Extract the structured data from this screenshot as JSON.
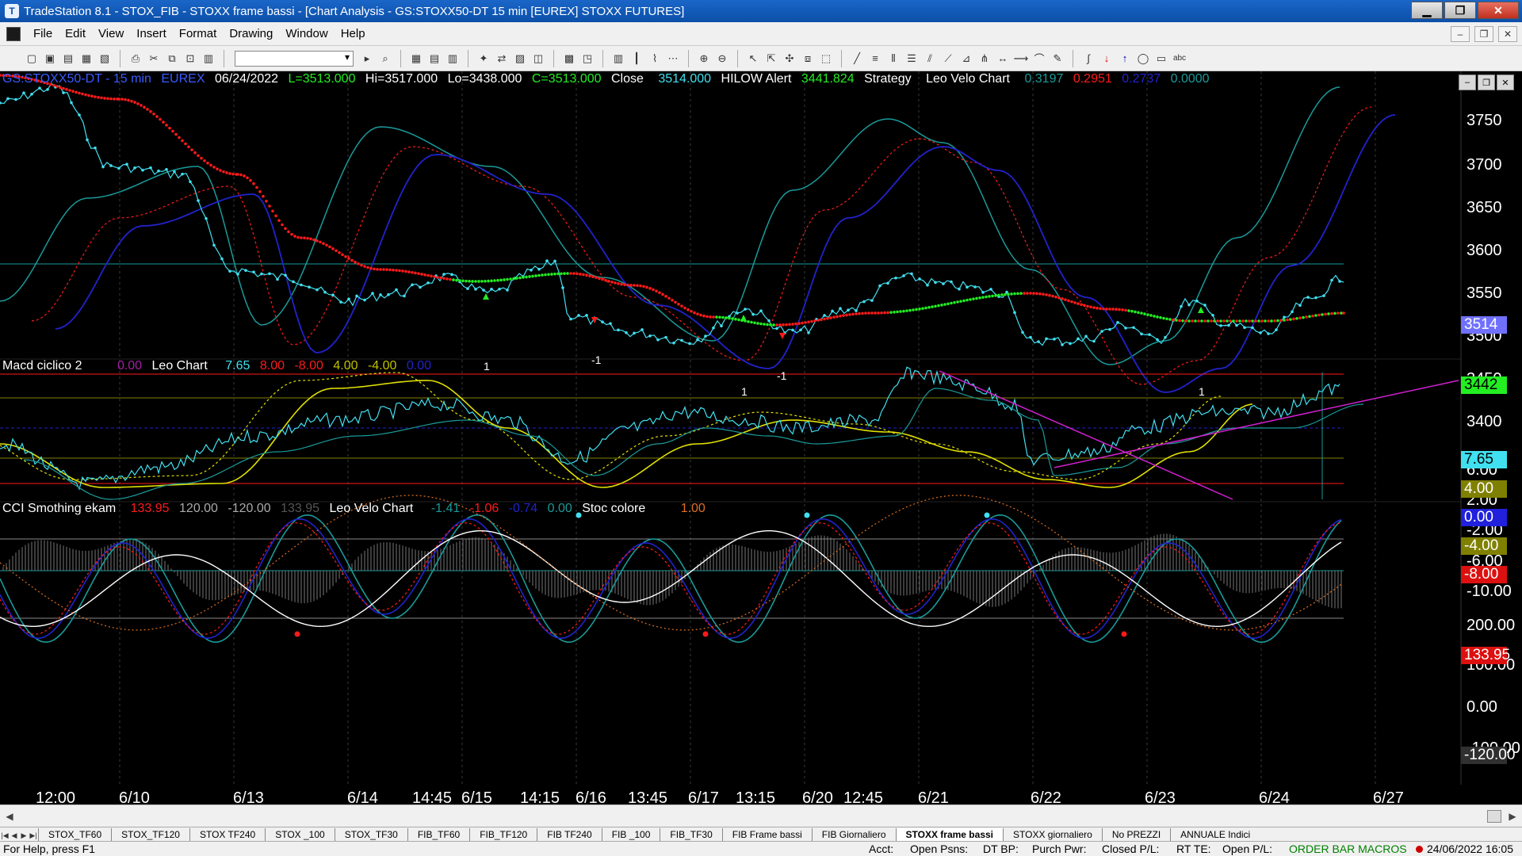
{
  "window": {
    "title": "TradeStation 8.1 - STOX_FIB - STOXX frame bassi - [Chart Analysis - GS:STOXX50-DT  15 min  [EUREX] STOXX FUTURES]",
    "minimize": "▁",
    "restore": "❐",
    "close": "✕"
  },
  "menu": [
    "File",
    "Edit",
    "View",
    "Insert",
    "Format",
    "Drawing",
    "Window",
    "Help"
  ],
  "chart": {
    "header": {
      "symbol": "GS:STOXX50-DT - 15 min",
      "exchange": "EUREX",
      "date": "06/24/2022",
      "last": "L=3513.000",
      "high": "Hi=3517.000",
      "low": "Lo=3438.000",
      "close_field": "C=3513.000",
      "close_label": "Close",
      "close_val": "3514.000",
      "hilow_label": "HILOW Alert",
      "hilow_val": "3441.824",
      "strategy_label": "Strategy",
      "leovelo_label": "Leo Velo Chart",
      "v1": "0.3197",
      "v2": "0.2951",
      "v3": "0.2737",
      "v4": "0.0000"
    },
    "macd_header": {
      "label": "Macd ciclico 2",
      "val": "0.00",
      "leo": "Leo Chart",
      "a": "7.65",
      "b": "8.00",
      "c": "-8.00",
      "d": "4.00",
      "e": "-4.00",
      "f": "0.00"
    },
    "cci_header": {
      "label": "CCI Smothing ekam",
      "a": "133.95",
      "b": "120.00",
      "c": "-120.00",
      "d": "133.95",
      "leo": "Leo Velo Chart",
      "e": "-1.41",
      "f": "-1.06",
      "g": "-0.74",
      "h": "0.00",
      "stoc": "Stoc colore",
      "i": "1.00"
    },
    "price_axis": [
      "3750",
      "3700",
      "3650",
      "3600",
      "3550",
      "3500",
      "3450",
      "3400"
    ],
    "price_tags": {
      "last": "3514",
      "hilow": "3442"
    },
    "macd_axis": [
      "6.00",
      "2.00",
      "-2.00",
      "-6.00",
      "-10.00"
    ],
    "macd_tags": {
      "a": "7.65",
      "d": "4.00",
      "f": "0.00",
      "e": "-4.00",
      "c": "-8.00"
    },
    "cci_axis": [
      "200.00",
      "100.00",
      "0.00",
      "-100.00"
    ],
    "cci_tags": {
      "a": "133.95",
      "c": "-120.00"
    },
    "x_axis": [
      "12:00",
      "6/10",
      "6/13",
      "6/14",
      "14:45",
      "6/15",
      "14:15",
      "6/16",
      "13:45",
      "6/17",
      "13:15",
      "6/20",
      "12:45",
      "6/21",
      "6/22",
      "6/23",
      "6/24",
      "6/27"
    ],
    "signals": [
      "1",
      "-1",
      "1",
      "-1",
      "1"
    ]
  },
  "tabs": [
    "STOX_TF60",
    "STOX_TF120",
    "STOX TF240",
    "STOX _100",
    "STOX_TF30",
    "FIB_TF60",
    "FIB_TF120",
    "FIB TF240",
    "FIB _100",
    "FIB_TF30",
    "FIB Frame bassi",
    "FIB Giornaliero",
    "STOXX frame bassi",
    "STOXX giornaliero",
    "No PREZZI",
    "ANNUALE Indici"
  ],
  "active_tab": "STOXX frame bassi",
  "status": {
    "help": "For Help, press F1",
    "acct": "Acct:",
    "open_psns": "Open Psns:",
    "dt_bp": "DT BP:",
    "purch_pwr": "Purch Pwr:",
    "closed_pl": "Closed P/L:",
    "rt_te": "RT TE:",
    "open_pl": "Open P/L:",
    "order_bar": "ORDER BAR  MACROS",
    "datetime": "24/06/2022 16:05"
  },
  "colors": {
    "cyan": "#40e0f0",
    "red": "#ff1a1a",
    "green": "#22ee22",
    "blue": "#2222cc",
    "yellow": "#e0e000",
    "magenta": "#d020d0",
    "teal": "#1a9a9a"
  }
}
